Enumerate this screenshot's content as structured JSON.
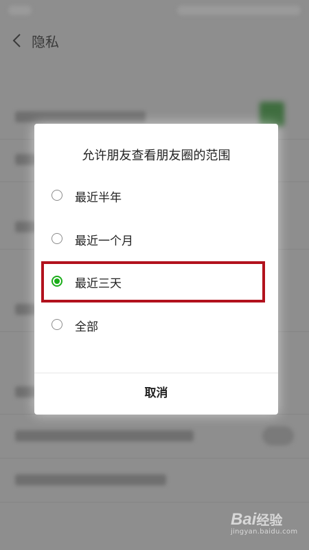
{
  "nav": {
    "title": "隐私"
  },
  "dialog": {
    "title": "允许朋友查看朋友圈的范围",
    "options": [
      {
        "label": "最近半年",
        "selected": false
      },
      {
        "label": "最近一个月",
        "selected": false
      },
      {
        "label": "最近三天",
        "selected": true
      },
      {
        "label": "全部",
        "selected": false
      }
    ],
    "cancel_label": "取消"
  },
  "colors": {
    "accent_green": "#1aad19",
    "highlight_red": "#b2121d"
  },
  "watermark": {
    "brand": "Bai",
    "brand_suffix": "经验",
    "url": "jingyan.baidu.com"
  }
}
